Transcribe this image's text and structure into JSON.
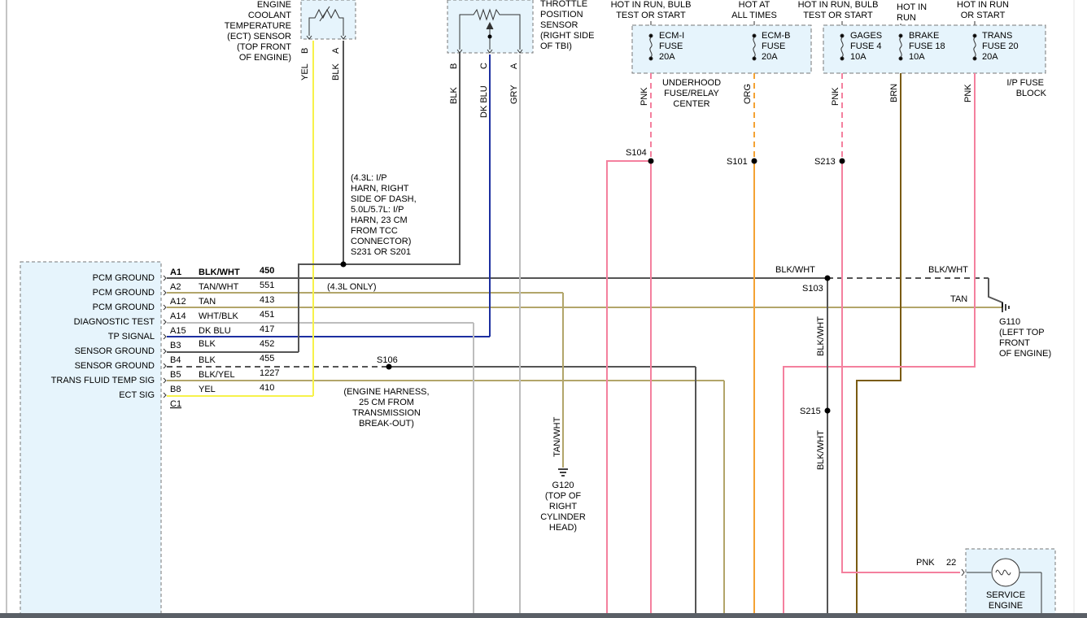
{
  "ect_sensor": {
    "title_lines": [
      "ENGINE",
      "COOLANT",
      "TEMPERATURE",
      "(ECT) SENSOR",
      "(TOP FRONT",
      "OF ENGINE)"
    ],
    "pins": [
      "B",
      "A"
    ],
    "wire_colors": [
      "YEL",
      "BLK"
    ]
  },
  "tp_sensor": {
    "title_lines": [
      "THROTTLE",
      "POSITION",
      "SENSOR",
      "(RIGHT SIDE",
      "OF TBI)"
    ],
    "pins": [
      "B",
      "C",
      "A"
    ],
    "wire_colors": [
      "BLK",
      "DK BLU",
      "GRY"
    ]
  },
  "power_headers": [
    {
      "lines": [
        "HOT IN RUN, BULB",
        "TEST OR START"
      ]
    },
    {
      "lines": [
        "HOT AT",
        "ALL TIMES"
      ]
    },
    {
      "lines": [
        "HOT IN RUN, BULB",
        "TEST OR START"
      ]
    },
    {
      "lines": [
        "HOT IN",
        "RUN"
      ]
    },
    {
      "lines": [
        "HOT IN RUN",
        "OR START"
      ]
    }
  ],
  "fuses": [
    {
      "name": "ECM-I",
      "label": "FUSE",
      "amps": "20A"
    },
    {
      "name": "ECM-B",
      "label": "FUSE",
      "amps": "20A"
    },
    {
      "name": "GAGES",
      "label": "FUSE 4",
      "amps": "10A"
    },
    {
      "name": "BRAKE",
      "label": "FUSE 18",
      "amps": "10A"
    },
    {
      "name": "TRANS",
      "label": "FUSE 20",
      "amps": "20A"
    }
  ],
  "underhood_block": {
    "lines": [
      "UNDERHOOD",
      "FUSE/RELAY",
      "CENTER"
    ]
  },
  "ip_block": {
    "lines": [
      "I/P FUSE",
      "BLOCK"
    ]
  },
  "fuse_wire_colors": [
    "PNK",
    "ORG",
    "PNK",
    "BRN",
    "PNK"
  ],
  "splices": {
    "s104": "S104",
    "s101": "S101",
    "s213": "S213",
    "s103": "S103",
    "s215": "S215",
    "s106": "S106"
  },
  "splice_note": {
    "lines": [
      "(4.3L: I/P",
      "HARN, RIGHT",
      "SIDE OF DASH,",
      "5.0L/5.7L: I/P",
      "HARN, 23 CM",
      "FROM TCC",
      "CONNECTOR)",
      "S231 OR S201"
    ]
  },
  "pcm_circuits": [
    {
      "label": "PCM GROUND",
      "pin": "A1",
      "color": "BLK/WHT",
      "circuit": "450"
    },
    {
      "label": "PCM GROUND",
      "pin": "A2",
      "color": "TAN/WHT",
      "circuit": "551"
    },
    {
      "label": "PCM GROUND",
      "pin": "A12",
      "color": "TAN",
      "circuit": "413"
    },
    {
      "label": "DIAGNOSTIC TEST",
      "pin": "A14",
      "color": "WHT/BLK",
      "circuit": "451"
    },
    {
      "label": "TP SIGNAL",
      "pin": "A15",
      "color": "DK BLU",
      "circuit": "417"
    },
    {
      "label": "SENSOR GROUND",
      "pin": "B3",
      "color": "BLK",
      "circuit": "452"
    },
    {
      "label": "SENSOR GROUND",
      "pin": "B4",
      "color": "BLK",
      "circuit": "455"
    },
    {
      "label": "TRANS FLUID TEMP SIG",
      "pin": "B5",
      "color": "BLK/YEL",
      "circuit": "1227"
    },
    {
      "label": "ECT SIG",
      "pin": "B8",
      "color": "YEL",
      "circuit": "410"
    }
  ],
  "pcm_extra_pin": "C1",
  "note_43l": "(4.3L ONLY)",
  "engine_harness_note": {
    "lines": [
      "(ENGINE HARNESS,",
      "25 CM FROM",
      "TRANSMISSION",
      "BREAK-OUT)"
    ]
  },
  "g120": {
    "lines": [
      "G120",
      "(TOP OF",
      "RIGHT",
      "CYLINDER",
      "HEAD)"
    ],
    "wire": "TAN/WHT"
  },
  "g110": {
    "lines": [
      "G110",
      "(LEFT TOP",
      "FRONT",
      "OF ENGINE)"
    ]
  },
  "right_labels": {
    "blkwht_left": "BLK/WHT",
    "blkwht_right": "BLK/WHT",
    "tan": "TAN",
    "vert_blkwht_1": "BLK/WHT",
    "vert_blkwht_2": "BLK/WHT"
  },
  "service_engine": {
    "wire": "PNK",
    "pin": "22",
    "lines": [
      "SERVICE",
      "ENGINE"
    ]
  },
  "colors": {
    "yel": "#f7f24a",
    "blk": "#555555",
    "dk_blu": "#1c2fa0",
    "gry": "#bdbdbd",
    "pnk": "#f4809e",
    "org": "#f4a233",
    "brn": "#7a5b12",
    "tan": "#b2a56a",
    "box_fill": "#e6f4fc"
  }
}
